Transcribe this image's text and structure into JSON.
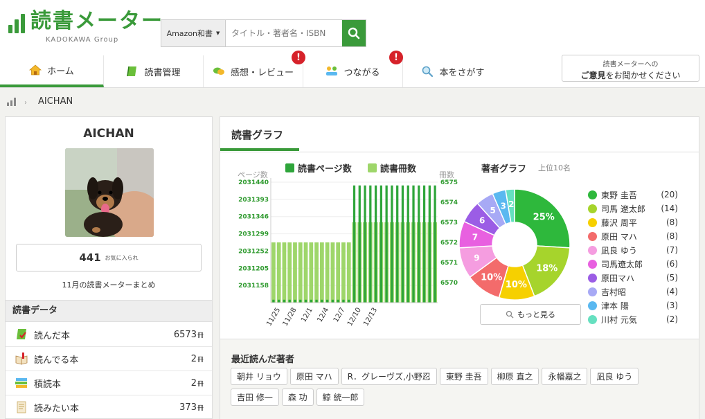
{
  "site": {
    "logo_text": "読書メーター",
    "logo_sub": "KADOKAWA Group",
    "search_scope": "Amazon和書",
    "search_placeholder": "タイトル・著者名・ISBN",
    "feedback_line1": "読書メーターへの",
    "feedback_bold": "ご意見",
    "feedback_rest": "をお聞かせください"
  },
  "nav": [
    {
      "label": "ホーム",
      "icon": "home-icon",
      "active": true
    },
    {
      "label": "読書管理",
      "icon": "book-icon"
    },
    {
      "label": "感想・レビュー",
      "icon": "speech-bubble-icon",
      "badge": "!"
    },
    {
      "label": "つながる",
      "icon": "people-icon",
      "badge": "!"
    },
    {
      "label": "本をさがす",
      "icon": "search-icon"
    }
  ],
  "breadcrumb": {
    "current": "AICHAN"
  },
  "profile": {
    "name": "AICHAN",
    "favorites_count": "441",
    "favorites_label": "お気に入られ",
    "summary_link": "11月の読書メーターまとめ",
    "data_header": "読書データ",
    "rows": [
      {
        "label": "読んだ本",
        "count": "6573",
        "unit": "冊",
        "icon": "read-book-icon"
      },
      {
        "label": "読んでる本",
        "count": "2",
        "unit": "冊",
        "icon": "reading-book-icon"
      },
      {
        "label": "積読本",
        "count": "2",
        "unit": "冊",
        "icon": "stacked-books-icon"
      },
      {
        "label": "読みたい本",
        "count": "373",
        "unit": "冊",
        "icon": "wishlist-book-icon"
      }
    ]
  },
  "graph": {
    "title": "読書グラフ",
    "more_button": "もっと見る",
    "recent_title": "最近読んだ著者",
    "recent_authors": [
      "朝井 リョウ",
      "原田 マハ",
      "R．グレーヴズ,小野忍",
      "東野 圭吾",
      "柳原 直之",
      "永幡嘉之",
      "凪良 ゆう",
      "吉田 修一",
      "森 功",
      "鯨 統一郎"
    ]
  },
  "colors": {
    "brand": "#3a9a3a",
    "pages_bar": "#2ea53a",
    "books_bar": "#9ed66a",
    "alert": "#d6222a"
  },
  "chart_data": [
    {
      "type": "bar",
      "title": "",
      "legend": [
        "読書ページ数",
        "読書冊数"
      ],
      "legend_placement": "top",
      "ylabel_left": "ページ数",
      "ylabel_right": "冊数",
      "y_left_ticks": [
        "2031440",
        "2031393",
        "2031346",
        "2031299",
        "2031252",
        "2031205",
        "2031158"
      ],
      "y_right_ticks": [
        "6575",
        "6574",
        "6573",
        "6572",
        "6571",
        "6570"
      ],
      "x_ticks": [
        "11/25",
        "11/28",
        "12/1",
        "12/4",
        "12/7",
        "12/10",
        "12/13"
      ],
      "ylim_left": [
        2031111,
        2031440
      ],
      "ylim_right": [
        6569,
        6575
      ],
      "series": [
        {
          "name": "読書ページ数",
          "axis": "left",
          "values": [
            2031119,
            2031119,
            2031119,
            2031119,
            2031119,
            2031119,
            2031119,
            2031119,
            2031119,
            2031119,
            2031119,
            2031119,
            2031119,
            2031119,
            2031119,
            2031431,
            2031431,
            2031431,
            2031431,
            2031431,
            2031431,
            2031431,
            2031431,
            2031431,
            2031431,
            2031431,
            2031431,
            2031431,
            2031431,
            2031431,
            2031431
          ]
        },
        {
          "name": "読書冊数",
          "axis": "right",
          "values": [
            6572,
            6572,
            6572,
            6572,
            6572,
            6572,
            6572,
            6572,
            6572,
            6572,
            6572,
            6572,
            6572,
            6572,
            6572,
            6573,
            6573,
            6573,
            6573,
            6573,
            6573,
            6573,
            6573,
            6573,
            6573,
            6573,
            6573,
            6573,
            6573,
            6573,
            6573
          ]
        }
      ]
    },
    {
      "type": "pie",
      "title": "著者グラフ",
      "subtitle": "上位10名",
      "categories": [
        "東野 圭吾",
        "司馬 遼太郎",
        "藤沢 周平",
        "原田 マハ",
        "凪良 ゆう",
        "司馬遼太郎",
        "原田マハ",
        "吉村昭",
        "津本 陽",
        "川村 元気"
      ],
      "values": [
        20,
        14,
        8,
        8,
        7,
        6,
        5,
        4,
        3,
        2
      ],
      "slice_labels": [
        "25%",
        "18%",
        "10%",
        "10%",
        "9",
        "7",
        "6",
        "5",
        "3",
        "2"
      ],
      "colors": [
        "#2eb83c",
        "#a6d42c",
        "#f6d000",
        "#f36b6b",
        "#f59de0",
        "#e860e0",
        "#9b5de5",
        "#a7a9f5",
        "#5ab8f0",
        "#66e0c0"
      ]
    }
  ]
}
